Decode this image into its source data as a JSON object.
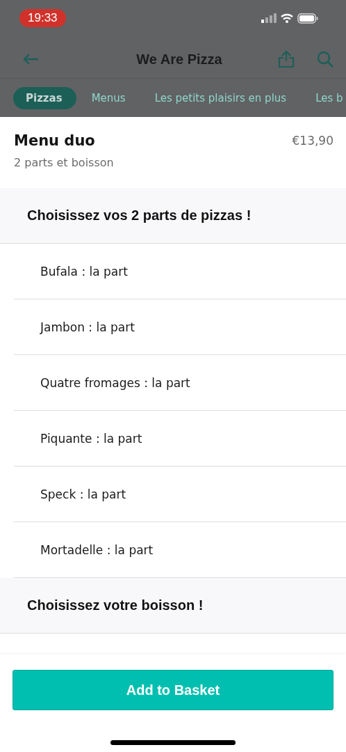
{
  "status_bar": {
    "time": "19:33"
  },
  "header": {
    "title": "We Are Pizza"
  },
  "tabs": [
    {
      "label": "Pizzas",
      "selected": true
    },
    {
      "label": "Menus",
      "selected": false
    },
    {
      "label": "Les petits plaisirs en plus",
      "selected": false
    },
    {
      "label": "Les b",
      "selected": false
    }
  ],
  "item": {
    "name": "Menu duo",
    "price": "€13,90",
    "description": "2 parts et boisson"
  },
  "sections": [
    {
      "title": "Choisissez vos 2 parts de pizzas !",
      "options": [
        "Bufala : la part",
        "Jambon : la part",
        "Quatre fromages : la part",
        "Piquante : la part",
        "Speck : la part",
        "Mortadelle : la part"
      ]
    },
    {
      "title": "Choisissez votre boisson !"
    }
  ],
  "add_button": {
    "label": "Add to Basket"
  }
}
